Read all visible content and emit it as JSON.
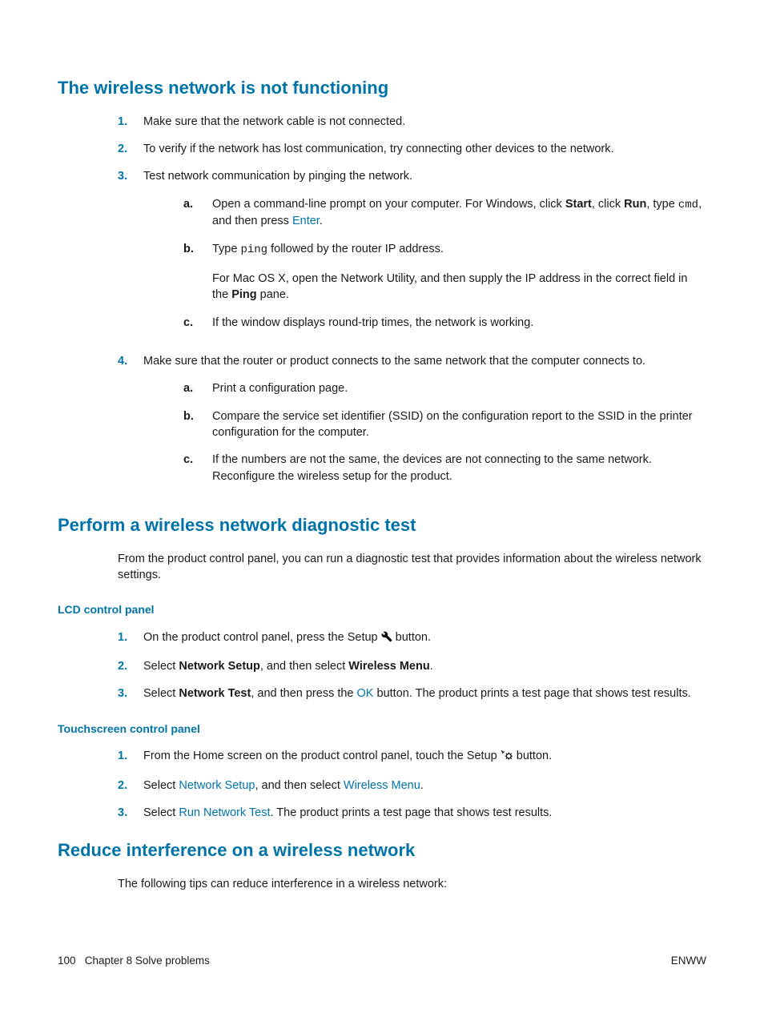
{
  "headings": {
    "h1": "The wireless network is not functioning",
    "h2": "Perform a wireless network diagnostic test",
    "h3": "Reduce interference on a wireless network",
    "sub1": "LCD control panel",
    "sub2": "Touchscreen control panel"
  },
  "s1": {
    "i1": "Make sure that the network cable is not connected.",
    "i2": "To verify if the network has lost communication, try connecting other devices to the network.",
    "i3": "Test network communication by pinging the network.",
    "i3a_pre": "Open a command-line prompt on your computer. For Windows, click ",
    "i3a_b1": "Start",
    "i3a_mid1": ", click ",
    "i3a_b2": "Run",
    "i3a_mid2": ", type ",
    "i3a_cmd": "cmd",
    "i3a_mid3": ", and then press ",
    "i3a_kbd": "Enter",
    "i3a_end": ".",
    "i3b_pre": "Type ",
    "i3b_cmd": "ping",
    "i3b_post": " followed by the router IP address.",
    "i3b_p2_pre": "For Mac OS X, open the Network Utility, and then supply the IP address in the correct field in the ",
    "i3b_p2_b": "Ping",
    "i3b_p2_post": " pane.",
    "i3c": "If the window displays round-trip times, the network is working.",
    "i4": "Make sure that the router or product connects to the same network that the computer connects to.",
    "i4a": "Print a configuration page.",
    "i4b": "Compare the service set identifier (SSID) on the configuration report to the SSID in the printer configuration for the computer.",
    "i4c": "If the numbers are not the same, the devices are not connecting to the same network. Reconfigure the wireless setup for the product."
  },
  "s2": {
    "intro": "From the product control panel, you can run a diagnostic test that provides information about the wireless network settings.",
    "lcd1_pre": "On the product control panel, press the Setup ",
    "lcd1_post": " button.",
    "lcd2_pre": "Select ",
    "lcd2_b1": "Network Setup",
    "lcd2_mid": ", and then select ",
    "lcd2_b2": "Wireless Menu",
    "lcd2_end": ".",
    "lcd3_pre": "Select ",
    "lcd3_b": "Network Test",
    "lcd3_mid": ", and then press the ",
    "lcd3_kbd": "OK",
    "lcd3_post": " button. The product prints a test page that shows test results.",
    "t1_pre": "From the Home screen on the product control panel, touch the Setup ",
    "t1_post": " button.",
    "t2_pre": "Select ",
    "t2_k1": "Network Setup",
    "t2_mid": ", and then select ",
    "t2_k2": "Wireless Menu",
    "t2_end": ".",
    "t3_pre": "Select ",
    "t3_k": "Run Network Test",
    "t3_post": ". The product prints a test page that shows test results."
  },
  "s3": {
    "intro": "The following tips can reduce interference in a wireless network:"
  },
  "nums": {
    "n1": "1.",
    "n2": "2.",
    "n3": "3.",
    "n4": "4."
  },
  "lets": {
    "a": "a.",
    "b": "b.",
    "c": "c."
  },
  "footer": {
    "page": "100",
    "chapter": "Chapter 8   Solve problems",
    "right": "ENWW"
  }
}
